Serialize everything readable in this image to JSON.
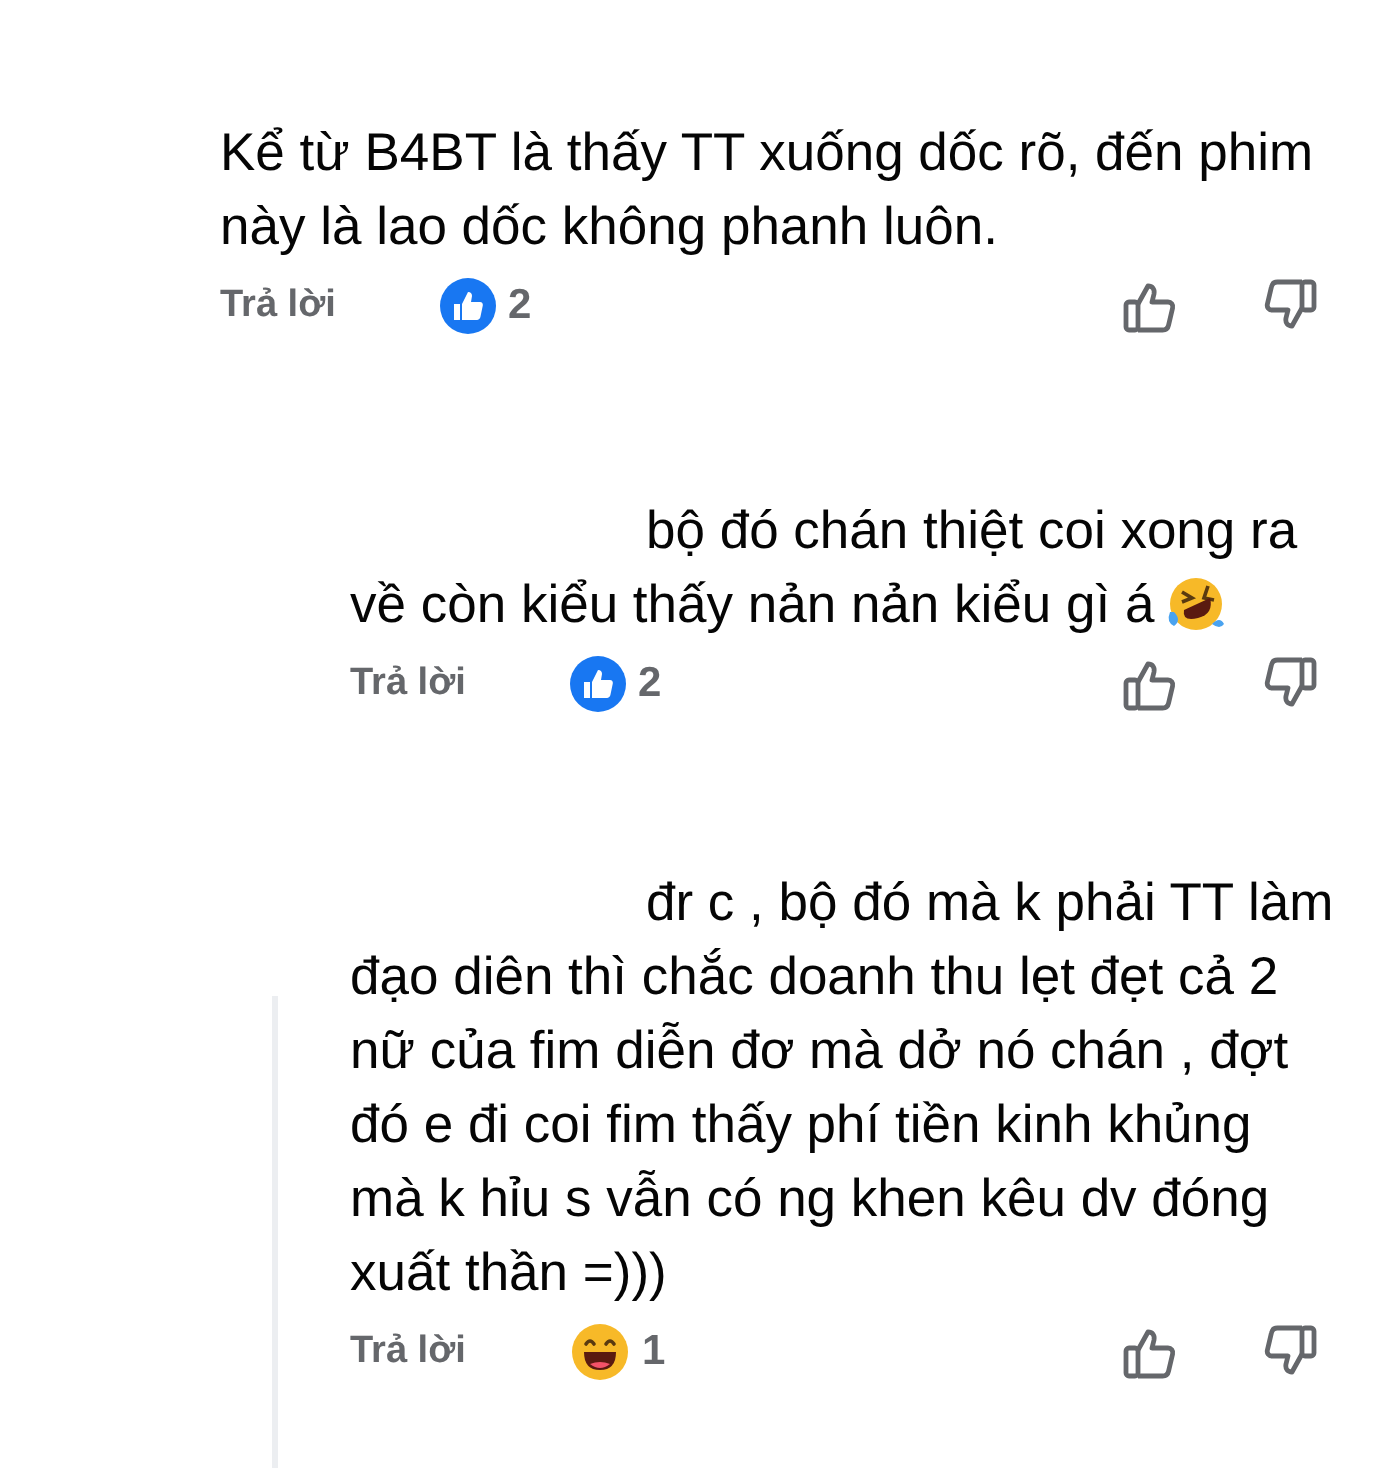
{
  "comments": [
    {
      "indent": false,
      "lines": [
        "Kể từ B4BT là thấy TT xuống dốc rõ, đến phim",
        "này là lao dốc không phanh luôn."
      ],
      "reply_label": "Trả lời",
      "reaction": {
        "kind": "like",
        "count": "2"
      }
    },
    {
      "indent": true,
      "lines": [
        "bộ đó chán thiệt coi xong ra",
        "về còn kiểu thấy nản nản kiểu gì á"
      ],
      "trailing_emoji": {
        "kind": "rofl"
      },
      "reply_label": "Trả lời",
      "reaction": {
        "kind": "like",
        "count": "2"
      }
    },
    {
      "indent": true,
      "lines": [
        "đr c , bộ đó mà k phải TT làm",
        "đạo diên thì chắc doanh thu lẹt đẹt cả 2",
        "nữ của fim diễn đơ mà dở nó chán , đợt",
        "đó e đi coi fim thấy phí tiền kinh khủng",
        "mà k hỉu s vẫn có ng khen kêu dv đóng",
        "xuất thần =)))"
      ],
      "reply_label": "Trả lời",
      "reaction": {
        "kind": "haha",
        "count": "1"
      }
    }
  ]
}
